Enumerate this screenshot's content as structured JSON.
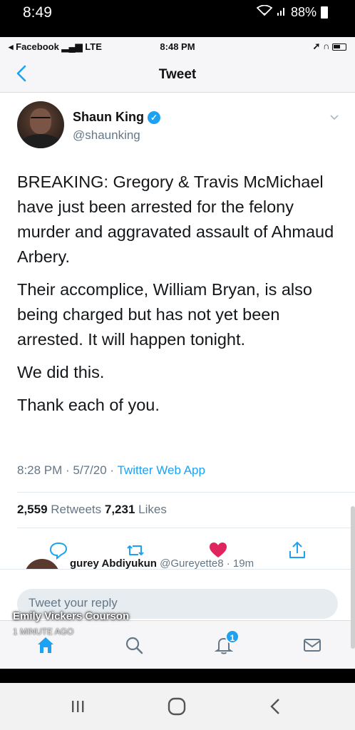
{
  "outer_status": {
    "time": "8:49",
    "battery": "88%"
  },
  "ios_status": {
    "carrier": "◂ Facebook",
    "network": "LTE",
    "time": "8:48 PM"
  },
  "nav": {
    "title": "Tweet"
  },
  "tweet": {
    "author_name": "Shaun King",
    "author_handle": "@shaunking",
    "paragraphs": [
      "BREAKING: Gregory & Travis McMichael have just been arrested for the felony murder and aggravated assault of Ahmaud Arbery.",
      "Their accomplice, William Bryan, is also being charged but has not yet been arrested. It will happen tonight.",
      "We did this.",
      "Thank each of you."
    ],
    "timestamp": "8:28 PM · 5/7/20 · ",
    "source": "Twitter Web App",
    "retweets_count": "2,559",
    "retweets_label": " Retweets ",
    "likes_count": "7,231",
    "likes_label": " Likes"
  },
  "next_reply": {
    "name": "gurey Abdiyukun",
    "meta": " @Gureyette8 · 19m"
  },
  "reply_box": {
    "placeholder": "Tweet your reply"
  },
  "overlay": {
    "name": "Emily Vickers Courson",
    "time": "1 MINUTE AGO"
  },
  "tabbar": {
    "notifications_badge": "1"
  },
  "colors": {
    "accent": "#1da1f2",
    "like": "#e0245e",
    "muted": "#657786"
  }
}
